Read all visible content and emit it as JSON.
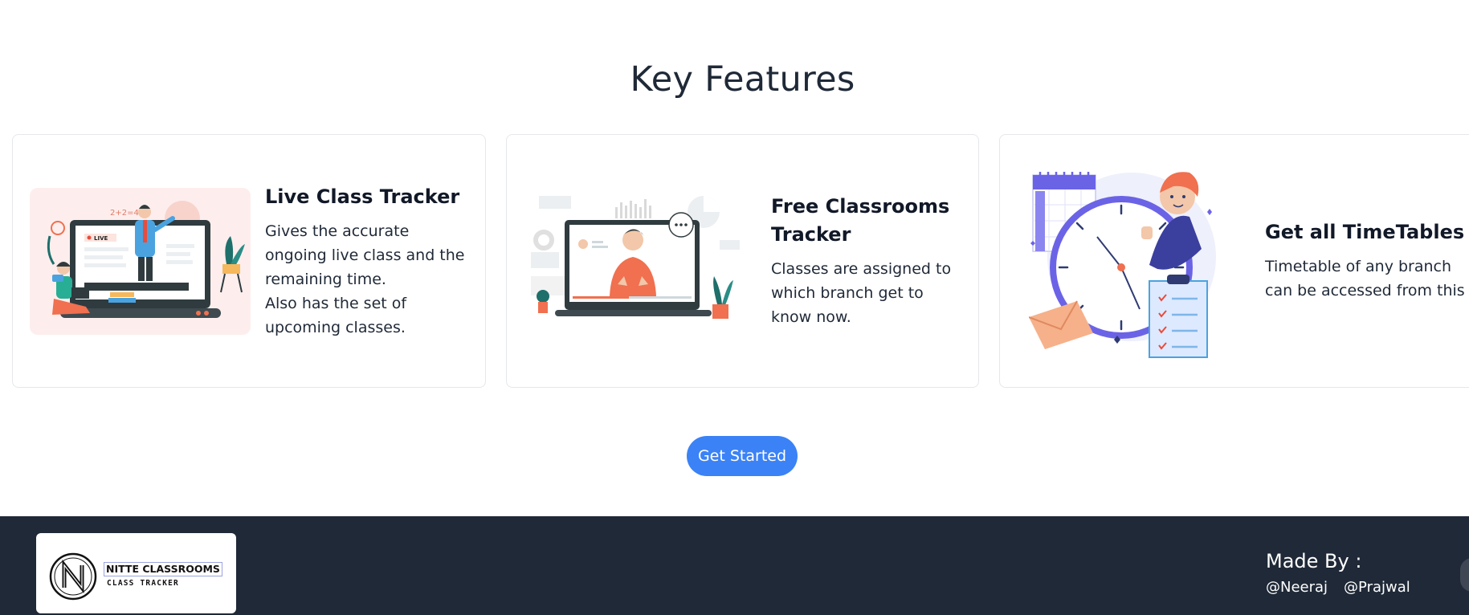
{
  "section": {
    "title": "Key Features"
  },
  "cards": [
    {
      "title": "Live Class Tracker",
      "body_lines": [
        "Gives the accurate ongoing live class and the remaining time.",
        "Also has the set of upcoming classes."
      ],
      "screen_badge": "LIVE",
      "board_text": "2+2=4"
    },
    {
      "title": "Free Classrooms Tracker",
      "body_lines": [
        "Classes are assigned to which branch get to know now."
      ]
    },
    {
      "title": "Get all TimeTables",
      "body_lines": [
        "Timetable of any branch can be accessed from this"
      ]
    }
  ],
  "cta": {
    "label": "Get Started"
  },
  "footer": {
    "logo_title": "NITTE CLASSROOMS",
    "logo_subtitle": "CLASS TRACKER",
    "made_by": "Made By :",
    "authors": [
      "@Neeraj",
      "@Prajwal"
    ]
  },
  "colors": {
    "accent": "#3b82f6",
    "footer_bg": "#1f2937",
    "illus_orange": "#f0704f",
    "illus_purple": "#6b63e6",
    "illus_teal": "#1f6f6b"
  }
}
